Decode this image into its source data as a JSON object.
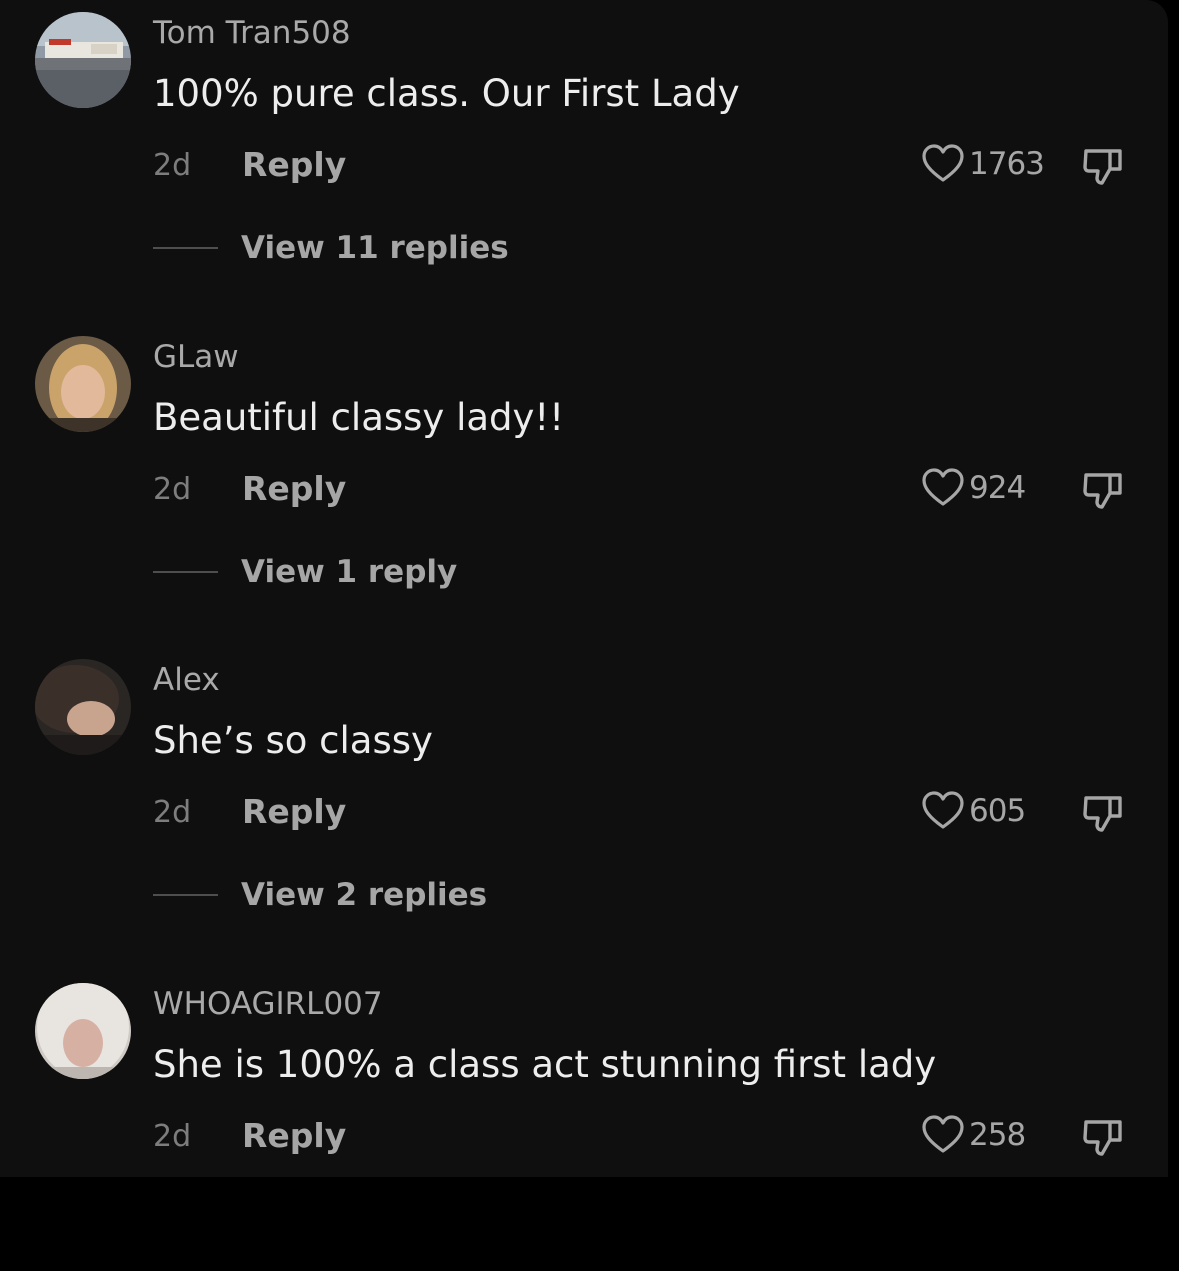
{
  "comments": [
    {
      "username": "Tom Tran508",
      "text": "100% pure class. Our First Lady",
      "time": "2d",
      "reply_label": "Reply",
      "likes": "1763",
      "view_replies": "View 11 replies",
      "avatar": "storefront-photo"
    },
    {
      "username": "GLaw",
      "text": "Beautiful classy lady!!",
      "time": "2d",
      "reply_label": "Reply",
      "likes": "924",
      "view_replies": "View 1 reply",
      "avatar": "woman-portrait-photo"
    },
    {
      "username": "Alex",
      "text": "She’s so classy",
      "time": "2d",
      "reply_label": "Reply",
      "likes": "605",
      "view_replies": "View 2 replies",
      "avatar": "woman-dark-hair-photo"
    },
    {
      "username": "WHOAGIRL007",
      "text": "She is 100% a class act stunning first lady",
      "time": "2d",
      "reply_label": "Reply",
      "likes": "258",
      "avatar": "woman-blonde-photo"
    }
  ],
  "icons": {
    "like": "heart-outline-icon",
    "dislike": "thumbs-down-outline-icon"
  },
  "colors": {
    "background": "#0f0f0f",
    "username": "#a9a9a9",
    "comment_text": "#ededed",
    "secondary": "#a6a6a6",
    "muted": "#7d7d7d"
  }
}
